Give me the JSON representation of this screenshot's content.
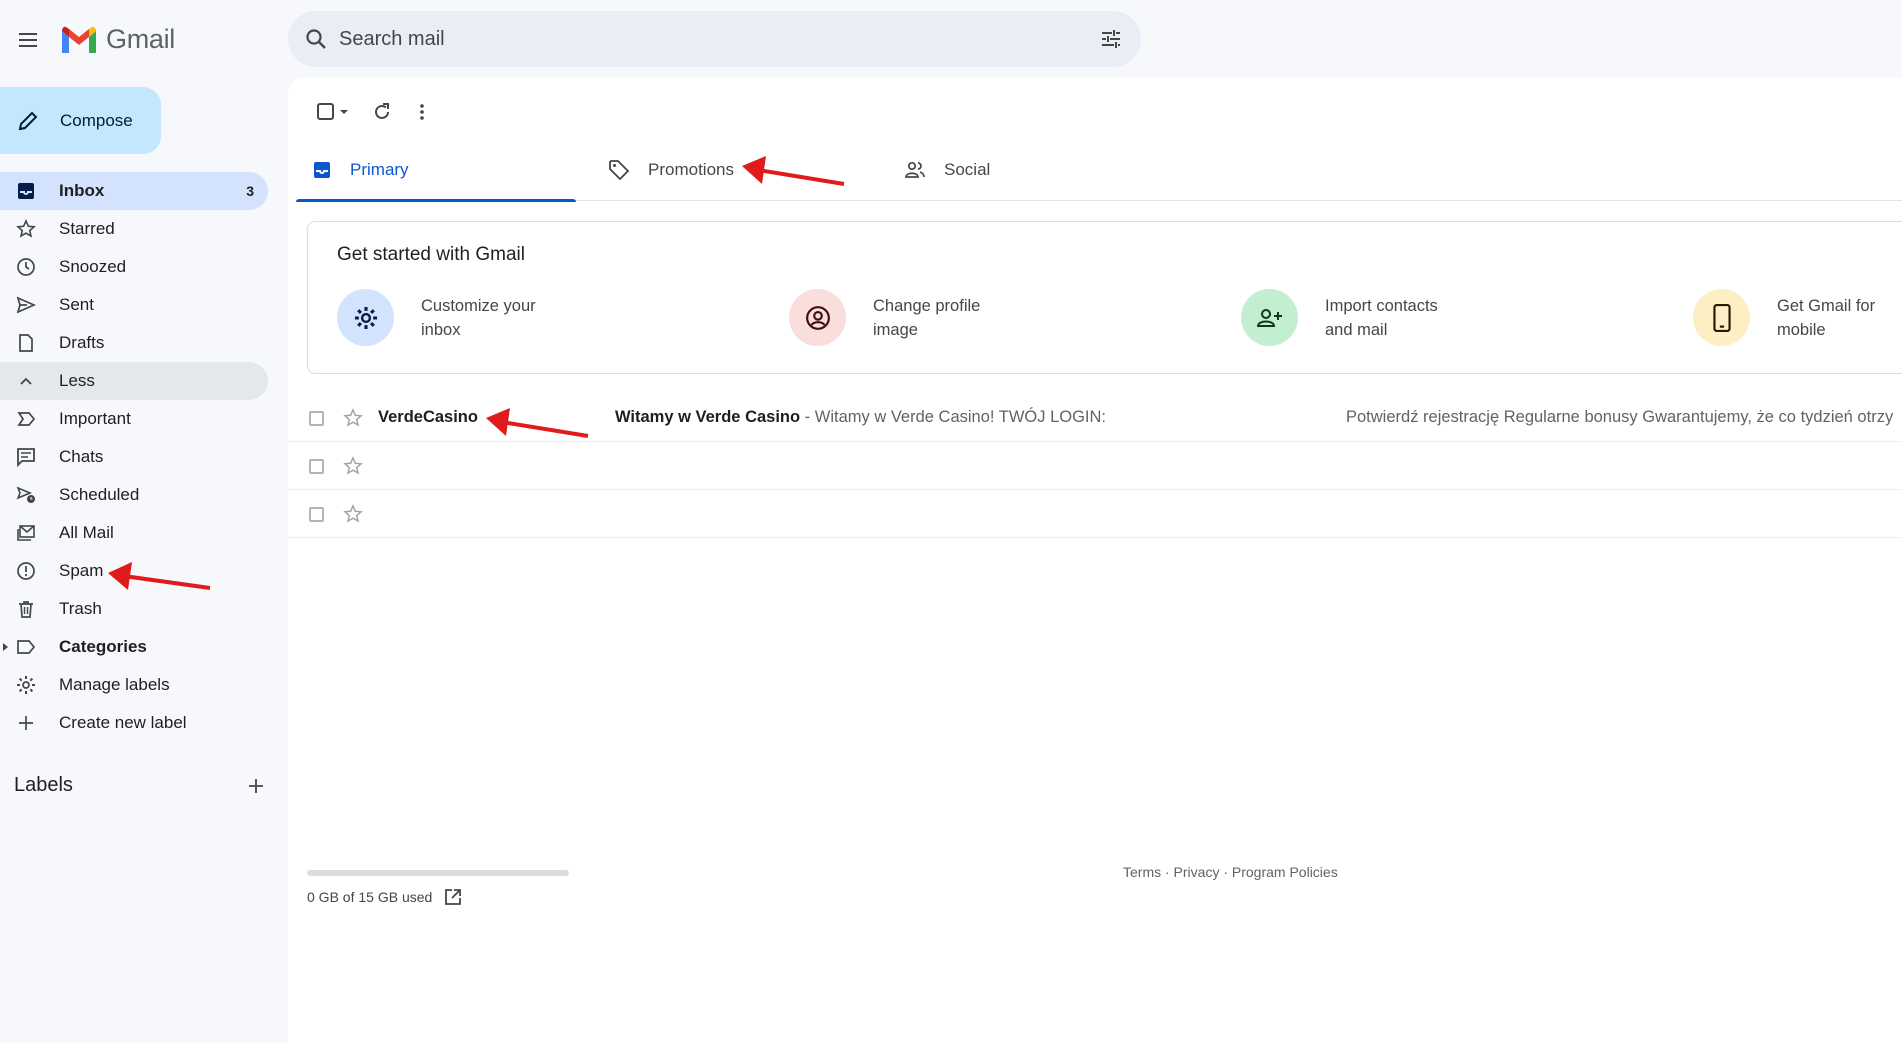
{
  "header": {
    "app_name": "Gmail",
    "search_placeholder": "Search mail"
  },
  "sidebar": {
    "compose_label": "Compose",
    "items": [
      {
        "label": "Inbox",
        "count": "3",
        "icon": "inbox-icon"
      },
      {
        "label": "Starred",
        "icon": "star-icon"
      },
      {
        "label": "Snoozed",
        "icon": "clock-icon"
      },
      {
        "label": "Sent",
        "icon": "send-icon"
      },
      {
        "label": "Drafts",
        "icon": "draft-icon"
      },
      {
        "label": "Less",
        "icon": "chevron-up-icon"
      },
      {
        "label": "Important",
        "icon": "important-icon"
      },
      {
        "label": "Chats",
        "icon": "chat-icon"
      },
      {
        "label": "Scheduled",
        "icon": "scheduled-icon"
      },
      {
        "label": "All Mail",
        "icon": "all-mail-icon"
      },
      {
        "label": "Spam",
        "icon": "spam-icon"
      },
      {
        "label": "Trash",
        "icon": "trash-icon"
      },
      {
        "label": "Categories",
        "icon": "label-icon"
      },
      {
        "label": "Manage labels",
        "icon": "gear-icon"
      },
      {
        "label": "Create new label",
        "icon": "plus-icon"
      }
    ],
    "labels_title": "Labels"
  },
  "tabs": [
    {
      "label": "Primary",
      "icon": "inbox-icon"
    },
    {
      "label": "Promotions",
      "icon": "tag-icon"
    },
    {
      "label": "Social",
      "icon": "people-icon"
    }
  ],
  "get_started": {
    "title": "Get started with Gmail",
    "items": [
      {
        "line1": "Customize your",
        "line2": "inbox",
        "icon": "gear-icon",
        "color": "#d3e3fd"
      },
      {
        "line1": "Change profile",
        "line2": "image",
        "icon": "account-circle-icon",
        "color": "#f9dedc"
      },
      {
        "line1": "Import contacts",
        "line2": "and mail",
        "icon": "person-add-icon",
        "color": "#c4eed0"
      },
      {
        "line1": "Get Gmail for",
        "line2": "mobile",
        "icon": "phone-icon",
        "color": "#fdefc3"
      }
    ]
  },
  "emails": [
    {
      "sender": "VerdeCasino",
      "subject": "Witamy w Verde Casino",
      "snippet": " - Witamy w Verde Casino! TWÓJ LOGIN:",
      "preview": "Potwierdź rejestrację Regularne bonusy Gwarantujemy, że co tydzień otrzy"
    },
    {
      "sender": "",
      "subject": "",
      "snippet": "",
      "preview": ""
    },
    {
      "sender": "",
      "subject": "",
      "snippet": "",
      "preview": ""
    }
  ],
  "footer": {
    "storage": "0 GB of 15 GB used",
    "links": "Terms · Privacy · Program Policies"
  },
  "colors": {
    "accent": "#0b57d0",
    "compose_bg": "#c2e7ff",
    "active_nav_bg": "#d3e3fd",
    "annotation_arrow": "#e01b1b"
  }
}
